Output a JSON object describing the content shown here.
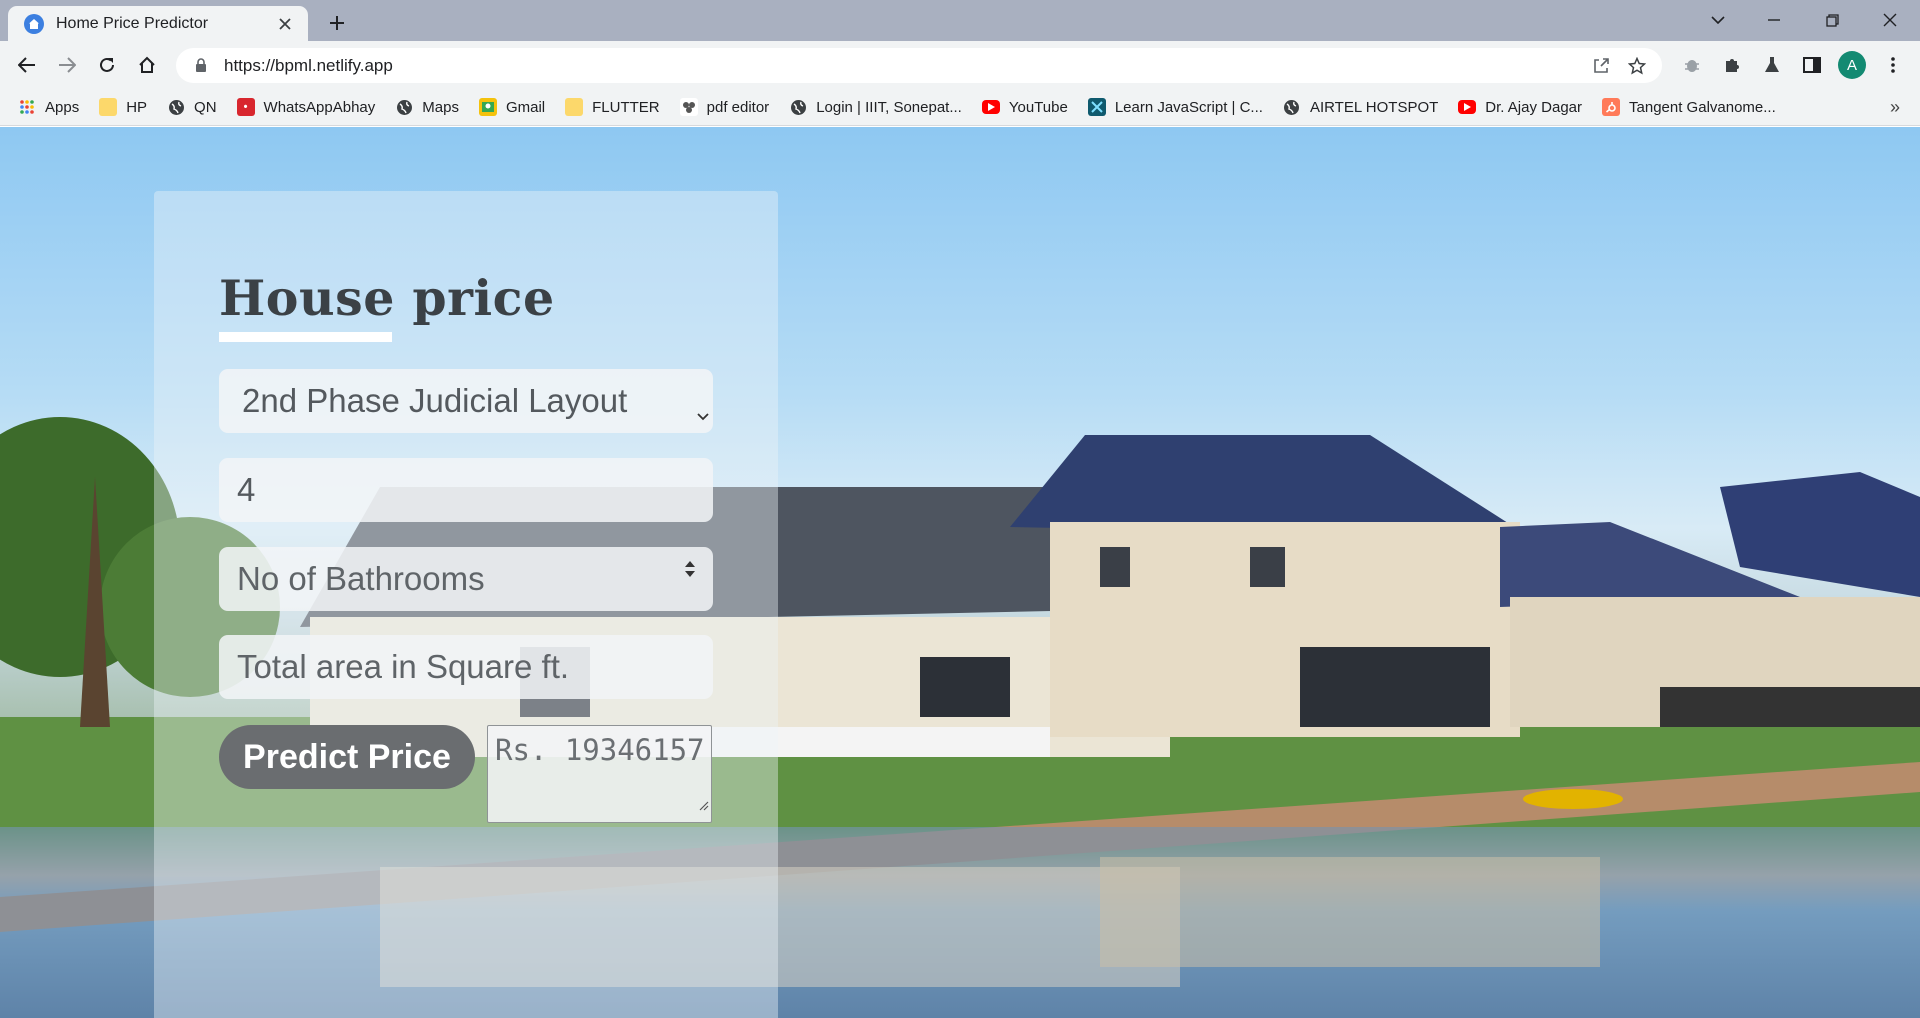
{
  "browser": {
    "tab_title": "Home Price Predictor",
    "url": "https://bpml.netlify.app",
    "profile_initial": "A",
    "bookmarks": [
      {
        "label": "Apps",
        "icon": "apps-grid-icon"
      },
      {
        "label": "HP",
        "icon": "folder-icon"
      },
      {
        "label": "QN",
        "icon": "globe-icon"
      },
      {
        "label": "WhatsAppAbhay",
        "icon": "red-site-icon"
      },
      {
        "label": "Maps",
        "icon": "globe-icon"
      },
      {
        "label": "Gmail",
        "icon": "gmail-icon"
      },
      {
        "label": "FLUTTER",
        "icon": "folder-icon"
      },
      {
        "label": "pdf editor",
        "icon": "pdf-editor-icon"
      },
      {
        "label": "Login | IIIT, Sonepat...",
        "icon": "globe-icon"
      },
      {
        "label": "YouTube",
        "icon": "youtube-icon"
      },
      {
        "label": "Learn JavaScript | C...",
        "icon": "learn-js-icon"
      },
      {
        "label": "AIRTEL HOTSPOT",
        "icon": "globe-icon"
      },
      {
        "label": "Dr. Ajay Dagar",
        "icon": "youtube-icon"
      },
      {
        "label": "Tangent Galvanome...",
        "icon": "hubspot-icon"
      }
    ]
  },
  "app": {
    "title": "House price",
    "location_selected": "2nd Phase Judicial Layout",
    "bhk_value": "4",
    "bathrooms_placeholder": "No of Bathrooms",
    "area_placeholder": "Total area in Square ft.",
    "predict_label": "Predict Price",
    "result_text": "Rs. 19346157"
  },
  "colors": {
    "panel_overlay": "rgba(235,243,248,0.42)",
    "button": "#6a6d70",
    "title": "#3b4146",
    "tabstrip": "#a9b0c0"
  }
}
